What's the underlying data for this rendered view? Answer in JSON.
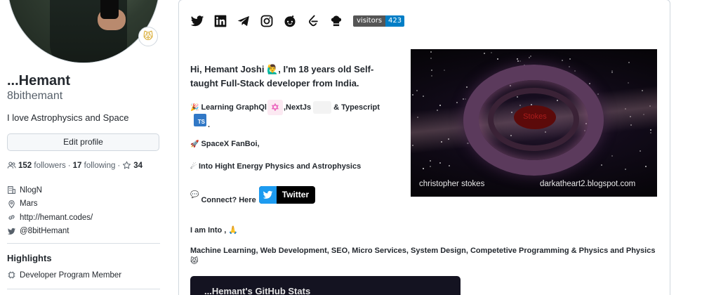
{
  "profile": {
    "status_emoji": "😾",
    "name": "...Hemant",
    "login": "8bithemant",
    "bio": "I love Astrophysics and Space",
    "edit_profile": "Edit profile",
    "followers_count": "152",
    "followers_label": "followers",
    "following_count": "17",
    "following_label": "following",
    "stars_count": "34",
    "separator": "·",
    "details": {
      "company": "NlogN",
      "location": "Mars",
      "website": "http://hemant.codes/",
      "twitter": "@8bitHemant"
    },
    "highlights_title": "Highlights",
    "highlight_item": "Developer Program Member"
  },
  "readme": {
    "socials": [
      "twitter-icon",
      "linkedin-icon",
      "telegram-icon",
      "instagram-icon",
      "reddit-icon",
      "leetcode-icon",
      "chef-icon"
    ],
    "visitors_label": "visitors",
    "visitors_count": "423",
    "intro": "Hi, Hemant Joshi 🙋‍♂️, I'm 18 years old Self-taught Full-Stack developer from India.",
    "learning_prefix": "Learning GraphQl",
    "learning_mid": ",NextJs",
    "learning_suffix": "& Typescript",
    "ts_label": "TS",
    "ts_dot": ".",
    "spacex": "SpaceX FanBoi,",
    "physics": "Into Hight Energy Physics and Astrophysics",
    "connect": "Connect? Here",
    "twitter_button": "Twitter",
    "into_label": "I am Into , 🙏",
    "topics": "Machine Learning, Web Development, SEO, Micro Services, System Design, Competetive Programming & Physics and Physics 😾",
    "stats_title": "...Hemant's GitHub Stats",
    "image": {
      "center_text": "Stokes",
      "caption_left": "christopher stokes",
      "caption_right": "darkatheart2.blogspot.com"
    }
  },
  "colors": {
    "badge_left": "#555555",
    "badge_right": "#007ec6",
    "twitter_blue": "#1d9bf0",
    "stats_bg": "#141321"
  }
}
